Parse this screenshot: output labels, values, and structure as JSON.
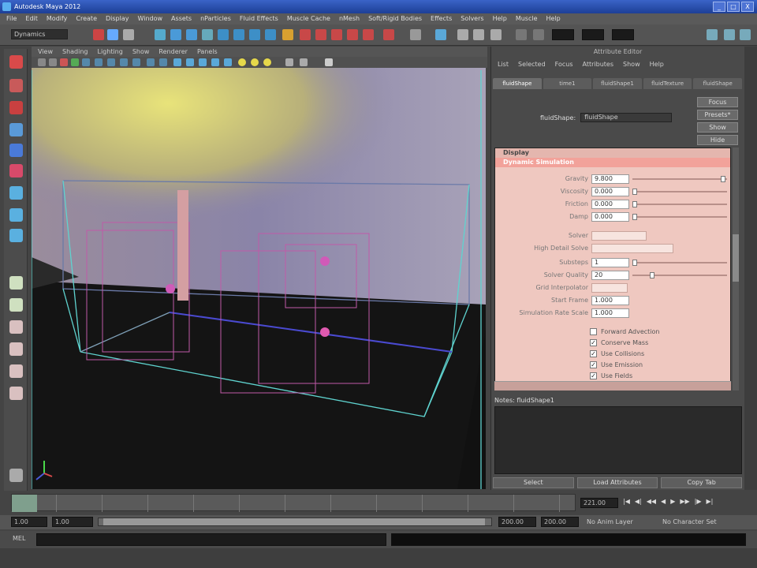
{
  "window": {
    "title": "Autodesk Maya 2012",
    "controls": [
      "_",
      "□",
      "X"
    ]
  },
  "menubar": [
    "File",
    "Edit",
    "Modify",
    "Create",
    "Display",
    "Window",
    "Assets",
    "nParticles",
    "Fluid Effects",
    "Muscle Cache",
    "nMesh",
    "Soft/Rigid Bodies",
    "Effects",
    "Solvers",
    "Help",
    "Muscle",
    "Help"
  ],
  "shelf": {
    "mode": "Dynamics"
  },
  "panel_menu": [
    "View",
    "Shading",
    "Lighting",
    "Show",
    "Renderer",
    "Panels"
  ],
  "attribute_editor": {
    "title": "Attribute Editor",
    "menu": [
      "List",
      "Selected",
      "Focus",
      "Attributes",
      "Show",
      "Help"
    ],
    "tabs": [
      "fluidShape",
      "time1",
      "fluidShape1",
      "fluidTexture",
      "fluidShape"
    ],
    "node_label": "fluidShape:",
    "node_value": "fluidShape",
    "side_buttons": [
      "Focus",
      "Presets*",
      "Show",
      "Hide"
    ],
    "sections": [
      "Display",
      "Dynamic Simulation"
    ],
    "attributes": [
      {
        "label": "Gravity",
        "value": "9.800"
      },
      {
        "label": "Viscosity",
        "value": "0.000"
      },
      {
        "label": "Friction",
        "value": "0.000"
      },
      {
        "label": "Damp",
        "value": "0.000"
      }
    ],
    "solver_rows": [
      {
        "label": "Solver"
      },
      {
        "label": "High Detail Solve"
      },
      {
        "label": "Substeps",
        "value": "1"
      },
      {
        "label": "Solver Quality",
        "value": "20"
      },
      {
        "label": "Grid Interpolator"
      },
      {
        "label": "Start Frame",
        "value": "1.000"
      },
      {
        "label": "Simulation Rate Scale",
        "value": "1.000"
      }
    ],
    "checkboxes": [
      {
        "label": "Forward Advection",
        "checked": false
      },
      {
        "label": "Conserve Mass",
        "checked": true
      },
      {
        "label": "Use Collisions",
        "checked": true
      },
      {
        "label": "Use Emission",
        "checked": true
      },
      {
        "label": "Use Fields",
        "checked": true
      }
    ],
    "notes_label": "Notes: fluidShape1",
    "buttons": [
      "Select",
      "Load Attributes",
      "Copy Tab"
    ]
  },
  "timeline": {
    "current_frame": "221.00",
    "playback": [
      "|◀",
      "◀|",
      "◀◀",
      "◀",
      "▶",
      "▶▶",
      "|▶",
      "▶|"
    ]
  },
  "range": {
    "start": "1.00",
    "start_inner": "1.00",
    "end_inner": "200.00",
    "end": "200.00",
    "anim_layer": "No Anim Layer",
    "char_set": "No Character Set"
  },
  "command": {
    "label": "MEL"
  }
}
